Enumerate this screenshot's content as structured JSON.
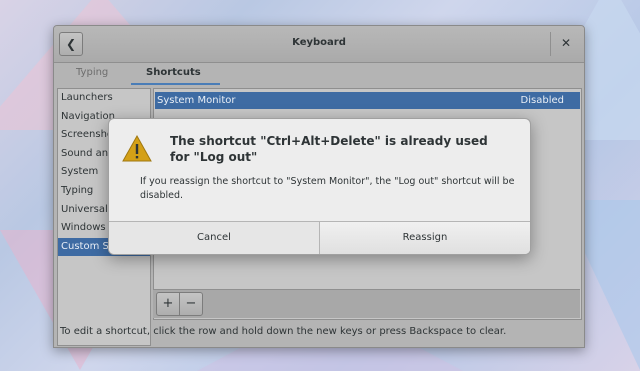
{
  "window": {
    "title": "Keyboard"
  },
  "tabs": [
    {
      "label": "Typing"
    },
    {
      "label": "Shortcuts"
    }
  ],
  "sidebar": {
    "items": [
      {
        "label": "Launchers"
      },
      {
        "label": "Navigation"
      },
      {
        "label": "Screenshots"
      },
      {
        "label": "Sound and Media"
      },
      {
        "label": "System"
      },
      {
        "label": "Typing"
      },
      {
        "label": "Universal Access"
      },
      {
        "label": "Windows"
      },
      {
        "label": "Custom Shortcuts"
      }
    ]
  },
  "shortcuts": [
    {
      "name": "System Monitor",
      "status": "Disabled"
    }
  ],
  "toolbar": {
    "add_label": "+",
    "remove_label": "−"
  },
  "hint": "To edit a shortcut, click the row and hold down the new keys or press Backspace to clear.",
  "dialog": {
    "title": "The shortcut \"Ctrl+Alt+Delete\" is already used for \"Log out\"",
    "body": "If you reassign the shortcut to \"System Monitor\", the \"Log out\" shortcut will be disabled.",
    "cancel_label": "Cancel",
    "reassign_label": "Reassign"
  },
  "colors": {
    "accent": "#3e6ba3"
  }
}
